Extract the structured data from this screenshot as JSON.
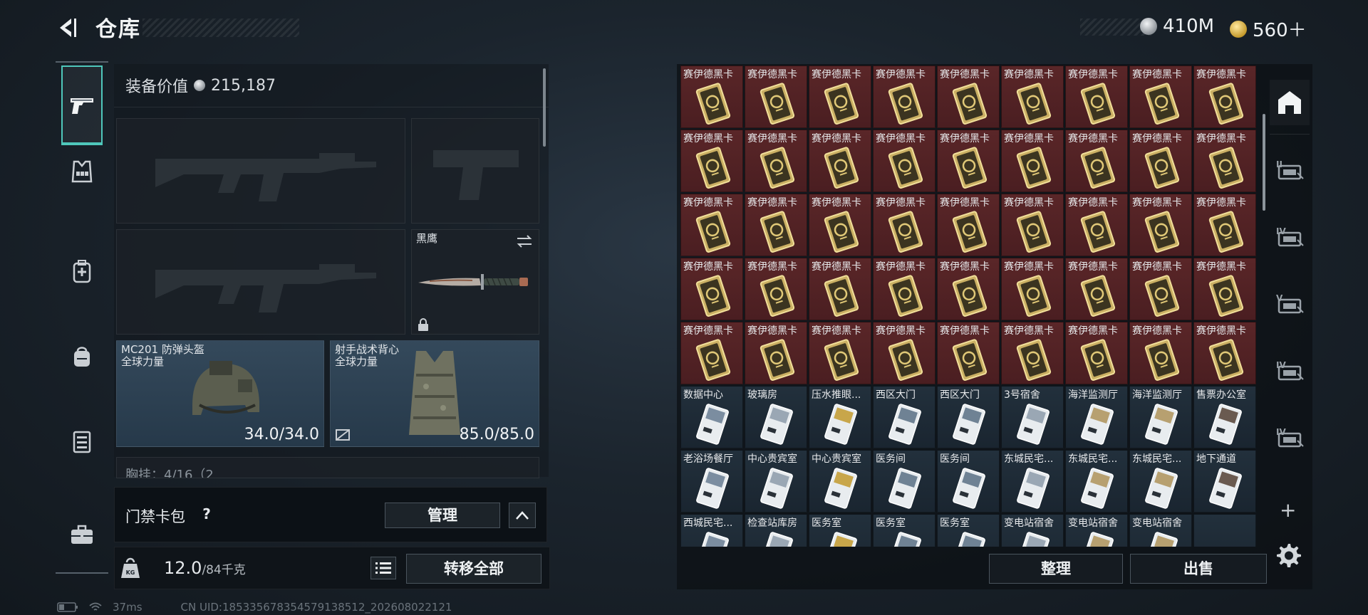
{
  "header": {
    "title": "仓库",
    "currency_silver": "410M",
    "currency_gold": "560＋"
  },
  "left_nav": [
    {
      "name": "weapons-tab",
      "icon": "pistol-icon",
      "active": true
    },
    {
      "name": "armor-tab",
      "icon": "vest-icon"
    },
    {
      "name": "medical-tab",
      "icon": "medkit-icon"
    },
    {
      "name": "backpack-tab",
      "icon": "backpack-icon"
    },
    {
      "name": "container-tab",
      "icon": "container-icon"
    },
    {
      "name": "case-tab",
      "icon": "briefcase-icon"
    }
  ],
  "equipment": {
    "value_label": "装备价值",
    "value": "215,187",
    "melee_name": "黑鹰",
    "helmet_name": "MC201 防弹头盔",
    "helmet_faction": "全球力量",
    "helmet_durability": "34.0/34.0",
    "vest_name": "射手战术背心",
    "vest_faction": "全球力量",
    "vest_durability": "85.0/85.0",
    "chest_rig_peek": "胸挂：4/16（2"
  },
  "card_bag": {
    "label": "门禁卡包",
    "help": "?",
    "manage_label": "管理"
  },
  "weight": {
    "current": "12.0",
    "max": "/84千克",
    "transfer_label": "转移全部"
  },
  "status_bar": {
    "ping": "37ms",
    "uid": "CN UID:185335678354579138512_202608022121"
  },
  "storage": {
    "rows": [
      {
        "style": "red",
        "labels": [
          "赛伊德黑卡",
          "赛伊德黑卡",
          "赛伊德黑卡",
          "赛伊德黑卡",
          "赛伊德黑卡",
          "赛伊德黑卡",
          "赛伊德黑卡",
          "赛伊德黑卡",
          "赛伊德黑卡"
        ]
      },
      {
        "style": "red",
        "labels": [
          "赛伊德黑卡",
          "赛伊德黑卡",
          "赛伊德黑卡",
          "赛伊德黑卡",
          "赛伊德黑卡",
          "赛伊德黑卡",
          "赛伊德黑卡",
          "赛伊德黑卡",
          "赛伊德黑卡"
        ]
      },
      {
        "style": "red",
        "labels": [
          "赛伊德黑卡",
          "赛伊德黑卡",
          "赛伊德黑卡",
          "赛伊德黑卡",
          "赛伊德黑卡",
          "赛伊德黑卡",
          "赛伊德黑卡",
          "赛伊德黑卡",
          "赛伊德黑卡"
        ]
      },
      {
        "style": "red",
        "labels": [
          "赛伊德黑卡",
          "赛伊德黑卡",
          "赛伊德黑卡",
          "赛伊德黑卡",
          "赛伊德黑卡",
          "赛伊德黑卡",
          "赛伊德黑卡",
          "赛伊德黑卡",
          "赛伊德黑卡"
        ]
      },
      {
        "style": "red",
        "labels": [
          "赛伊德黑卡",
          "赛伊德黑卡",
          "赛伊德黑卡",
          "赛伊德黑卡",
          "赛伊德黑卡",
          "赛伊德黑卡",
          "赛伊德黑卡",
          "赛伊德黑卡",
          "赛伊德黑卡"
        ]
      },
      {
        "style": "dark",
        "labels": [
          "数据中心",
          "玻璃房",
          "压水推眼...",
          "西区大门",
          "西区大门",
          "3号宿舍",
          "海洋监测厅",
          "海洋监测厅",
          "售票办公室"
        ]
      },
      {
        "style": "dark",
        "labels": [
          "老浴场餐厅",
          "中心贵宾室",
          "中心贵宾室",
          "医务间",
          "医务间",
          "东城民宅...",
          "东城民宅...",
          "东城民宅...",
          "地下通道"
        ]
      },
      {
        "style": "dark",
        "labels": [
          "西城民宅...",
          "检查站库房",
          "医务室",
          "医务室",
          "医务室",
          "变电站宿舍",
          "变电站宿舍",
          "变电站宿舍",
          ""
        ]
      }
    ],
    "sort_label": "整理",
    "sell_label": "出售",
    "add_tab": "+"
  },
  "right_tabs": [
    {
      "name": "tab-storage-main",
      "icon": "house-icon"
    },
    {
      "name": "tab-storage-2",
      "icon": "container-ii-icon",
      "tier": "II"
    },
    {
      "name": "tab-storage-3",
      "icon": "container-iv-icon",
      "tier": "IV"
    },
    {
      "name": "tab-storage-4",
      "icon": "container-v-icon",
      "tier": "V"
    },
    {
      "name": "tab-storage-5",
      "icon": "container-iv-icon",
      "tier": "IV"
    },
    {
      "name": "tab-storage-6",
      "icon": "container-iv-icon",
      "tier": "IV"
    }
  ],
  "colors": {
    "accent": "#4fc7bb",
    "red_cell": "#5a2628",
    "dark_cell": "#22303c",
    "card_gold": "#d6b85a"
  }
}
